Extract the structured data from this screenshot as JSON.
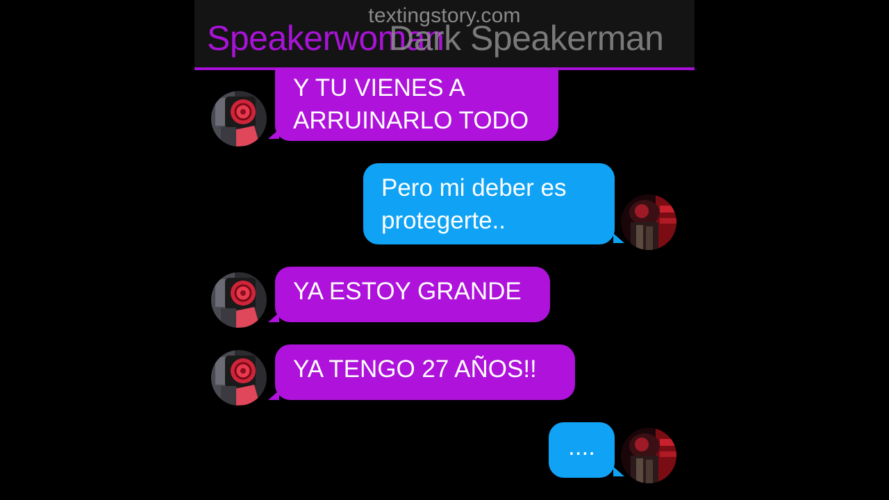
{
  "header": {
    "watermark": "textingstory.com",
    "contact_left": "Speakerwoman",
    "contact_right": "Dark Speakerman",
    "accent_color": "#a80fd6"
  },
  "messages": [
    {
      "sender": "Speakerwoman",
      "side": "left",
      "color": "#ae12db",
      "lines": [
        "Y TU VIENES A",
        "ARRUINARLO TODO"
      ]
    },
    {
      "sender": "Dark Speakerman",
      "side": "right",
      "color": "#10a3f5",
      "lines": [
        "Pero mi deber es",
        "protegerte.."
      ]
    },
    {
      "sender": "Speakerwoman",
      "side": "left",
      "color": "#ae12db",
      "lines": [
        "YA ESTOY GRANDE"
      ]
    },
    {
      "sender": "Speakerwoman",
      "side": "left",
      "color": "#ae12db",
      "lines": [
        "YA TENGO 27 AÑOS!!"
      ]
    },
    {
      "sender": "Dark Speakerman",
      "side": "right",
      "color": "#10a3f5",
      "lines": [
        "...."
      ]
    }
  ],
  "icons": {
    "left_avatar": "speakerwoman-avatar-icon",
    "right_avatar": "dark-speakerman-avatar-icon"
  }
}
